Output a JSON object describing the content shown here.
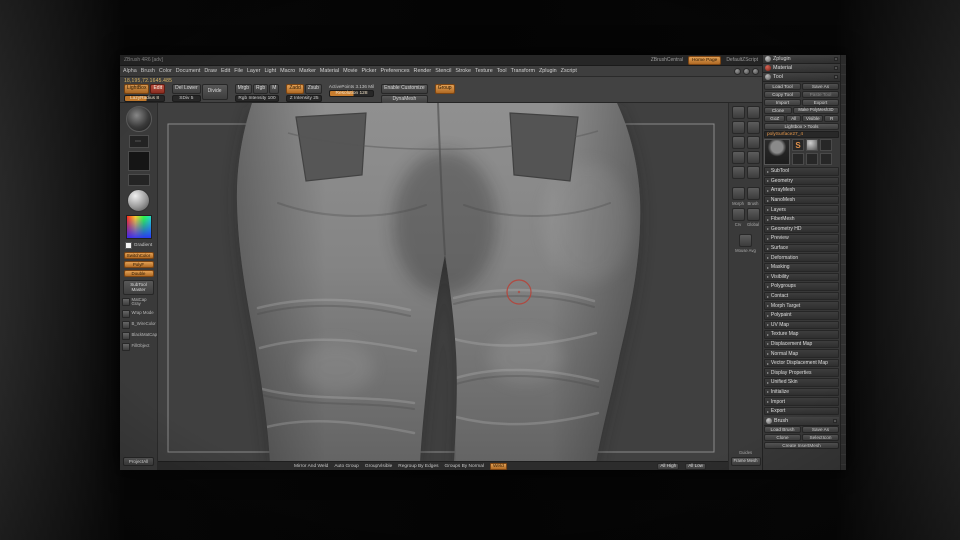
{
  "colors": {
    "accent_orange": "#d08a3e",
    "record_red": "#b0443a",
    "canvas_gray": "#404040",
    "panel_gray": "#383838"
  },
  "titlebar": {
    "left": "ZBrush 4R6 [adv]",
    "center": "ZBrushCentral",
    "badge": "Home Page",
    "right": "DefaultZScript"
  },
  "menubar": {
    "menus": [
      "Alpha",
      "Brush",
      "Color",
      "Document",
      "Draw",
      "Edit",
      "File",
      "Layer",
      "Light",
      "Macro",
      "Marker",
      "Material",
      "Movie",
      "Picker",
      "Preferences",
      "Render",
      "Stencil",
      "Stroke",
      "Texture",
      "Tool",
      "Transform",
      "Zplugin",
      "Zscript"
    ]
  },
  "toolbar": {
    "readout": "18,195,72.1645.485",
    "lightbox": "LightBox",
    "edit": "Edit",
    "lazy_slider": "LazyRadius 8",
    "del_lower": "Del Lower",
    "divide": "Divide",
    "sdiv": "SDiv 5",
    "mrgb": "Mrgb",
    "rgb": "Rgb",
    "m": "M",
    "rgb_slider": "Rgb Intensity 100",
    "zadd": "Zadd",
    "zsub": "Zsub",
    "z_slider": "Z Intensity 25",
    "active_points": "ActivePoints 3.136 Mil",
    "resolution": "Resolution 128",
    "enable_customize": "Enable Customize",
    "dynamesh": "DynaMesh",
    "group": "Group"
  },
  "left_shelf": {
    "stroke_glyph": "⋯",
    "gradient_label": "Gradient",
    "chips": [
      "SwitchColor",
      "PolyF",
      "Double"
    ],
    "subtool_master": "SubTool Master",
    "macros": [
      {
        "label": "MatCap Gray"
      },
      {
        "label": "Wrap Mode"
      },
      {
        "label": "B_WireColor"
      },
      {
        "label": "BlackMatCap"
      },
      {
        "label": "FillObject"
      }
    ],
    "project_all": "ProjectAll"
  },
  "canvas": {
    "bottom_bar": {
      "items": [
        "Mirror And Weld",
        "Auto Group",
        "GroupVisible",
        "Regroup By Edges",
        "Groups By Normal"
      ],
      "accent": "Weld",
      "all_high": "All High",
      "all_low": "All Low"
    }
  },
  "right_shelf": {
    "top_icons": [
      {
        "name": "bpr-icon"
      },
      {
        "name": "scroll-icon"
      },
      {
        "name": "zoom-icon"
      },
      {
        "name": "actual-icon"
      },
      {
        "name": "aahalf-icon"
      },
      {
        "name": "persp-icon"
      },
      {
        "name": "floor-icon"
      },
      {
        "name": "local-icon"
      },
      {
        "name": "lsym-icon"
      },
      {
        "name": "frame-icon"
      }
    ],
    "mid": [
      {
        "label": "Morph"
      },
      {
        "label": "Brush"
      },
      {
        "label": "Crv"
      },
      {
        "label": "Global"
      }
    ],
    "mouse_avg": "Mouse Avg",
    "guides": "Guides",
    "frame_mesh": "Frame Mesh"
  },
  "right_panel": {
    "tabs": [
      {
        "label": "Zplugin"
      },
      {
        "label": "Material"
      },
      {
        "label": "Tool"
      }
    ],
    "tool": {
      "load": "Load Tool",
      "save_as": "Save As",
      "copy": "Copy Tool",
      "paste": "Paste Tool",
      "import": "Import",
      "export": "Export",
      "clone": "Clone",
      "make_poly": "Make PolyMesh3D",
      "goz": "GoZ",
      "goz_all": "All",
      "goz_visible": "Visible",
      "goz_r": "R",
      "lightbox_tools": "Lightbox > Tools",
      "active_tool": "polySurface27_4",
      "quick_s": "S",
      "sections": [
        "SubTool",
        "Geometry",
        "ArrayMesh",
        "NanoMesh",
        "Layers",
        "FiberMesh",
        "Geometry HD",
        "Preview",
        "Surface",
        "Deformation",
        "Masking",
        "Visibility",
        "Polygroups",
        "Contact",
        "Morph Target",
        "Polypaint",
        "UV Map",
        "Texture Map",
        "Displacement Map",
        "Normal Map",
        "Vector Displacement Map",
        "Display Properties",
        "Unified Skin",
        "Initialize",
        "Import",
        "Export"
      ]
    },
    "brush": {
      "title": "Brush",
      "load": "Load Brush",
      "save_as": "Save As",
      "clone": "Clone",
      "select_icon": "SelectIcon",
      "create_insert": "Create InsertMesh"
    }
  }
}
